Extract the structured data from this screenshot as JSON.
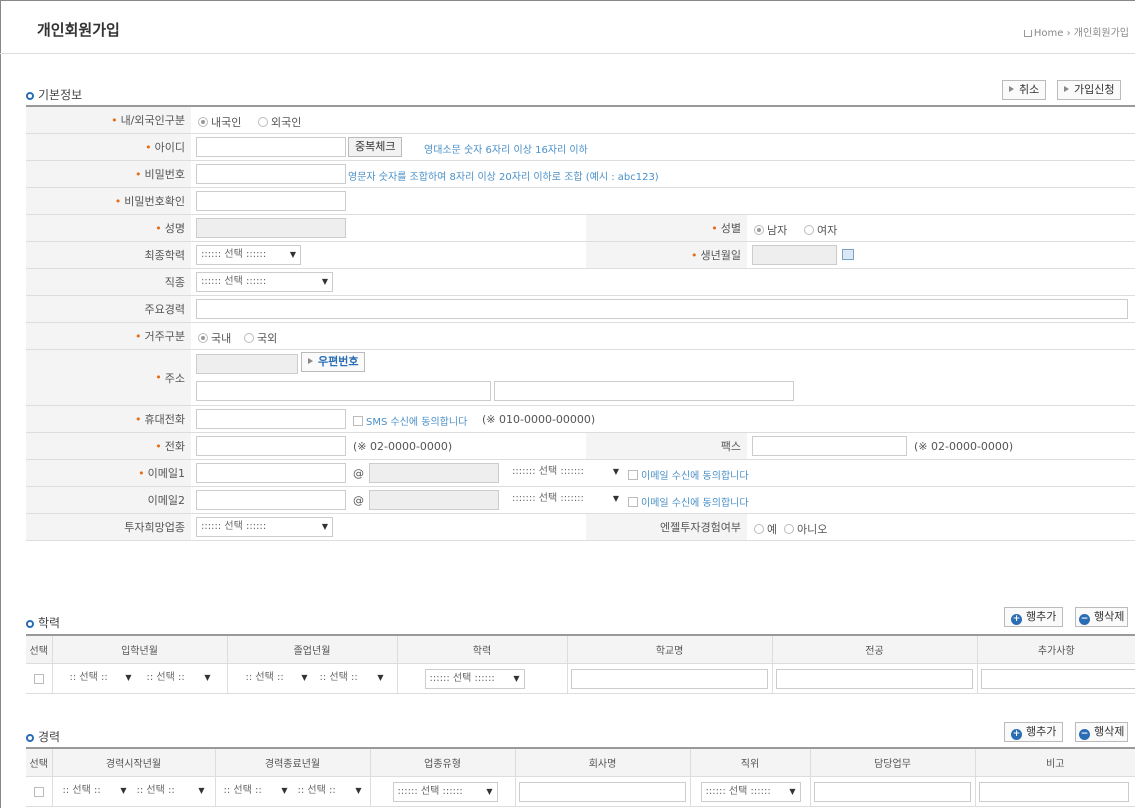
{
  "page": {
    "title": "개인회원가입",
    "breadcrumb": "Home › 개인회원가입"
  },
  "basic": {
    "section": "기본정보",
    "cancel": "취소",
    "submit": "가입신청",
    "nationality": {
      "label": "내/외국인구분",
      "opt1": "내국인",
      "opt2": "외국인"
    },
    "userid": {
      "label": "아이디",
      "check": "중복체크",
      "hint": "영대소문 숫자 6자리 이상 16자리 이하"
    },
    "password": {
      "label": "비밀번호",
      "hint": "영문자 숫자를 조합하여 8자리 이상 20자리 이하로 조합 (예시 : abc123)"
    },
    "password_confirm": {
      "label": "비밀번호확인"
    },
    "name": {
      "label": "성명"
    },
    "gender": {
      "label": "성별",
      "opt1": "남자",
      "opt2": "여자"
    },
    "education": {
      "label": "최종학력",
      "select": ":::::: 선택 :::::: "
    },
    "birth": {
      "label": "생년월일"
    },
    "job": {
      "label": "직종",
      "select": ":::::: 선택 ::::::"
    },
    "career": {
      "label": "주요경력"
    },
    "residence": {
      "label": "거주구분",
      "opt1": "국내",
      "opt2": "국외"
    },
    "address": {
      "label": "주소",
      "zip": "우편번호"
    },
    "mobile": {
      "label": "휴대전화",
      "sms": "SMS 수신에 동의합니다",
      "example": "(※ 010-0000-00000)"
    },
    "phone": {
      "label": "전화",
      "example": "(※ 02-0000-0000)"
    },
    "fax": {
      "label": "팩스",
      "example": "(※ 02-0000-0000)"
    },
    "email1": {
      "label": "이메일1",
      "at": "@",
      "select": "::::::: 선택 :::::::",
      "agree": "이메일 수신에 동의합니다"
    },
    "email2": {
      "label": "이메일2",
      "at": "@",
      "select": "::::::: 선택 :::::::",
      "agree": "이메일 수신에 동의합니다"
    },
    "invest_field": {
      "label": "투자희망업종",
      "select": ":::::: 선택 ::::::"
    },
    "angel": {
      "label": "엔젤투자경험여부",
      "opt1": "예",
      "opt2": "아니오"
    }
  },
  "education": {
    "section": "학력",
    "add": "행추가",
    "del": "행삭제",
    "headers": [
      "선택",
      "입학년월",
      "졸업년월",
      "학력",
      "학교명",
      "전공",
      "추가사항"
    ],
    "sel_small": ":: 선택 ::",
    "sel_edu": ":::::: 선택 ::::::"
  },
  "career": {
    "section": "경력",
    "add": "행추가",
    "del": "행삭제",
    "headers": [
      "선택",
      "경력시작년월",
      "경력종료년월",
      "업종유형",
      "회사명",
      "직위",
      "담당업무",
      "비고"
    ],
    "sel_small": ":: 선택 ::",
    "sel_type": ":::::: 선택 ::::::",
    "sel_pos": ":::::: 선택 ::::::"
  },
  "colors": {
    "accent": "#2a6db5",
    "required": "#e56d16",
    "hint": "#4a90c8"
  }
}
